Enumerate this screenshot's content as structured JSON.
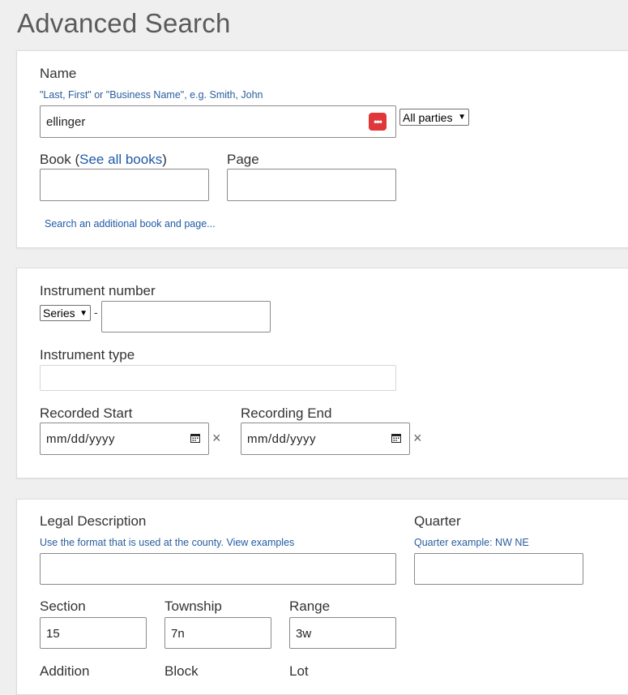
{
  "page": {
    "title": "Advanced Search"
  },
  "name_section": {
    "label": "Name",
    "hint": "\"Last, First\" or \"Business Name\", e.g. Smith, John",
    "value": "ellinger",
    "party_select": "All parties",
    "book_label_prefix": "Book (",
    "book_link": "See all books",
    "book_label_suffix": ")",
    "page_label": "Page",
    "add_book_link": "Search an additional book and page..."
  },
  "instrument_section": {
    "number_label": "Instrument number",
    "series_select": "Series",
    "dash": "-",
    "type_label": "Instrument type",
    "recorded_start_label": "Recorded Start",
    "recording_end_label": "Recording End",
    "date_placeholder": "mm/dd/yyyy",
    "clear_glyph": "×"
  },
  "legal_section": {
    "label": "Legal Description",
    "hint_prefix": "Use the format that is used at the county. ",
    "hint_link": "View examples",
    "quarter_label": "Quarter",
    "quarter_hint": "Quarter example: NW NE",
    "section_label": "Section",
    "section_value": "15",
    "township_label": "Township",
    "township_value": "7n",
    "range_label": "Range",
    "range_value": "3w",
    "addition_label": "Addition",
    "block_label": "Block",
    "lot_label": "Lot"
  }
}
